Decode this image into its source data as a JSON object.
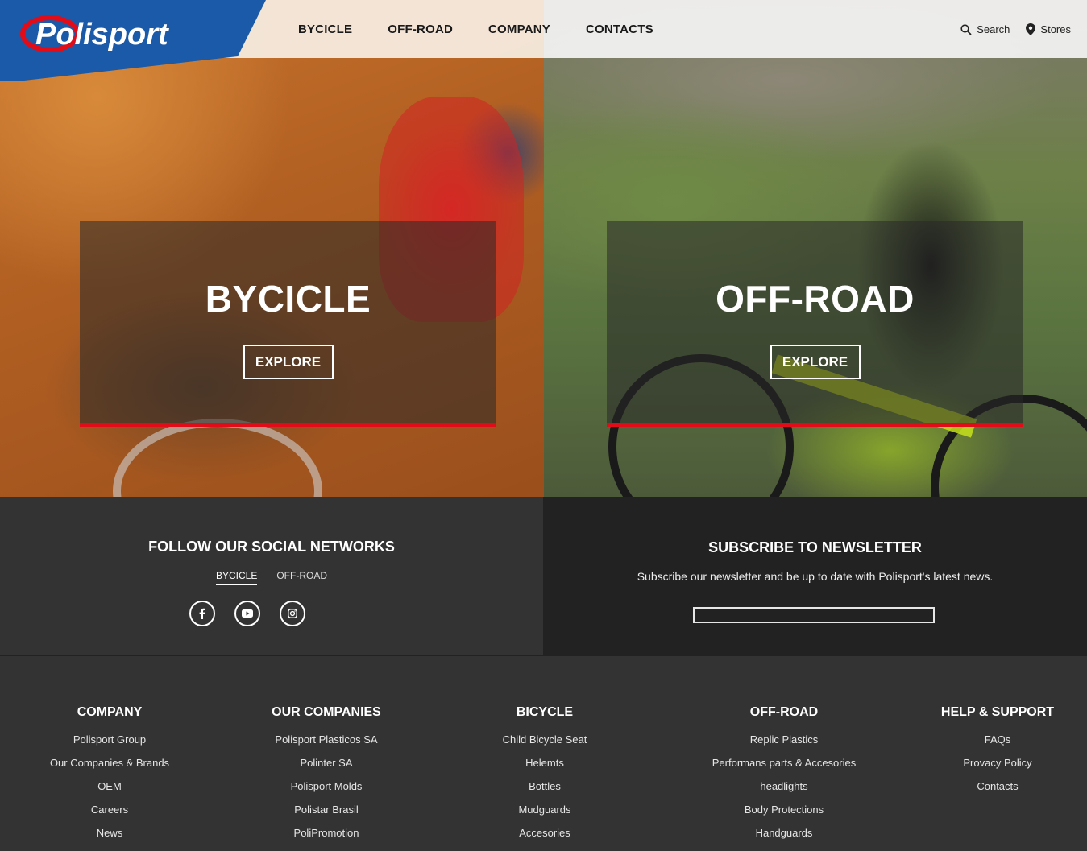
{
  "header": {
    "brand": "Polisport",
    "nav": [
      {
        "label": "BYCICLE"
      },
      {
        "label": "OFF-ROAD"
      },
      {
        "label": "COMPANY"
      },
      {
        "label": "CONTACTS"
      }
    ],
    "search_label": "Search",
    "stores_label": "Stores"
  },
  "hero": {
    "left": {
      "title": "BYCICLE",
      "button": "EXPLORE"
    },
    "right": {
      "title": "OFF-ROAD",
      "button": "EXPLORE"
    }
  },
  "social": {
    "title": "FOLLOW OUR SOCIAL NETWORKS",
    "tabs": [
      {
        "label": "BYCICLE",
        "active": true
      },
      {
        "label": "OFF-ROAD",
        "active": false
      }
    ],
    "icons": [
      "facebook-icon",
      "youtube-icon",
      "instagram-icon"
    ]
  },
  "newsletter": {
    "title": "SUBSCRIBE TO NEWSLETTER",
    "text": "Subscribe our newsletter and be up to date with Polisport's latest news.",
    "input_value": ""
  },
  "footer": {
    "columns": [
      {
        "title": "COMPANY",
        "links": [
          "Polisport Group",
          "Our Companies & Brands",
          "OEM",
          "Careers",
          "News"
        ]
      },
      {
        "title": "OUR COMPANIES",
        "links": [
          "Polisport Plasticos SA",
          "Polinter SA",
          "Polisport Molds",
          "Polistar Brasil",
          "PoliPromotion"
        ]
      },
      {
        "title": "BICYCLE",
        "links": [
          "Child Bicycle Seat",
          "Helemts",
          "Bottles",
          "Mudguards",
          "Accesories"
        ]
      },
      {
        "title": "OFF-ROAD",
        "links": [
          "Replic Plastics",
          "Performans parts & Accesories",
          "headlights",
          "Body Protections",
          "Handguards"
        ]
      },
      {
        "title": "HELP & SUPPORT",
        "links": [
          "FAQs",
          "Provacy Policy",
          "Contacts"
        ]
      }
    ]
  },
  "colors": {
    "brand_blue": "#1a5aa8",
    "accent_red": "#e10c17",
    "dark_panel": "#333333",
    "darker_panel": "#222222"
  }
}
